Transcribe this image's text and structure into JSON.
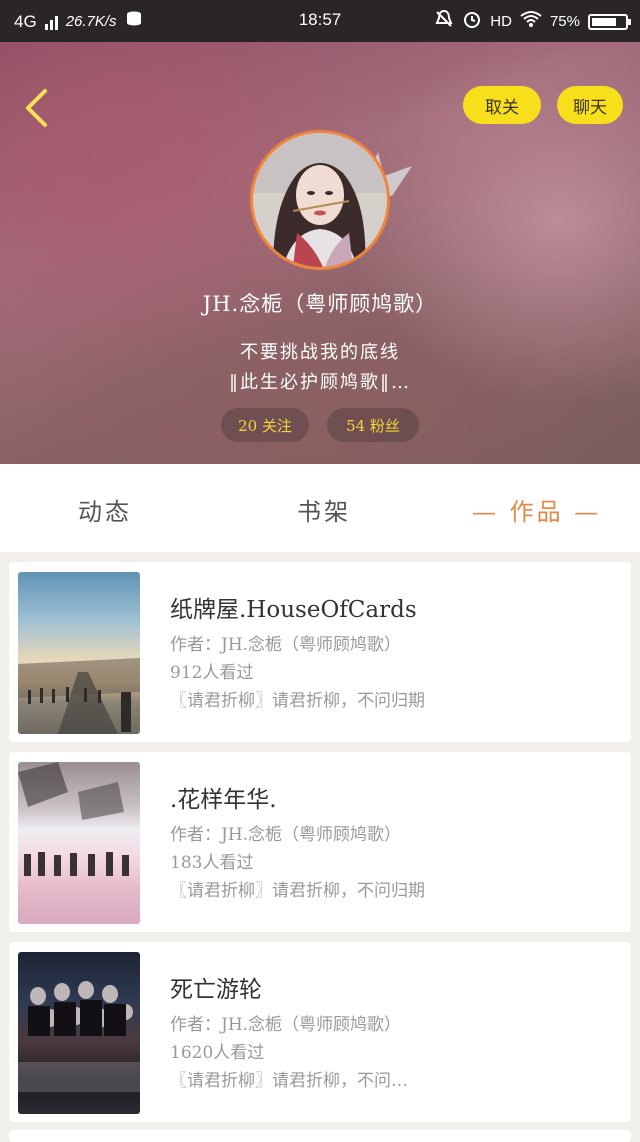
{
  "status_bar": {
    "network": "4G",
    "speed": "26.7K/s",
    "time": "18:57",
    "hd": "HD",
    "battery": "75%",
    "battery_level": 0.75
  },
  "header": {
    "unfollow_label": "取关",
    "chat_label": "聊天"
  },
  "profile": {
    "nickname": "JH.念栀（粤师顾鸠歌）",
    "bio_line1": "不要挑战我的底线",
    "bio_line2": "‖此生必护顾鸠歌‖…",
    "following": "20 关注",
    "followers": "54 粉丝"
  },
  "tabs": {
    "dynamic": "动态",
    "bookshelf": "书架",
    "works": "— 作品 —"
  },
  "books": [
    {
      "title": "纸牌屋.HouseOfCards",
      "author": "作者：JH.念栀（粤师顾鸠歌）",
      "views": "912人看过",
      "desc": "〖请君折柳〗请君折柳，不问归期"
    },
    {
      "title": ".花样年华.",
      "author": "作者：JH.念栀（粤师顾鸠歌）",
      "views": "183人看过",
      "desc": "〖请君折柳〗请君折柳，不问归期"
    },
    {
      "title": "死亡游轮",
      "author": "作者：JH.念栀（粤师顾鸠歌）",
      "views": "1620人看过",
      "desc": "〖请君折柳〗请君折柳，不问…"
    }
  ],
  "colors": {
    "accent_yellow": "#f8df1c",
    "avatar_ring": "#f0843a",
    "active_tab": "#e58a45"
  }
}
